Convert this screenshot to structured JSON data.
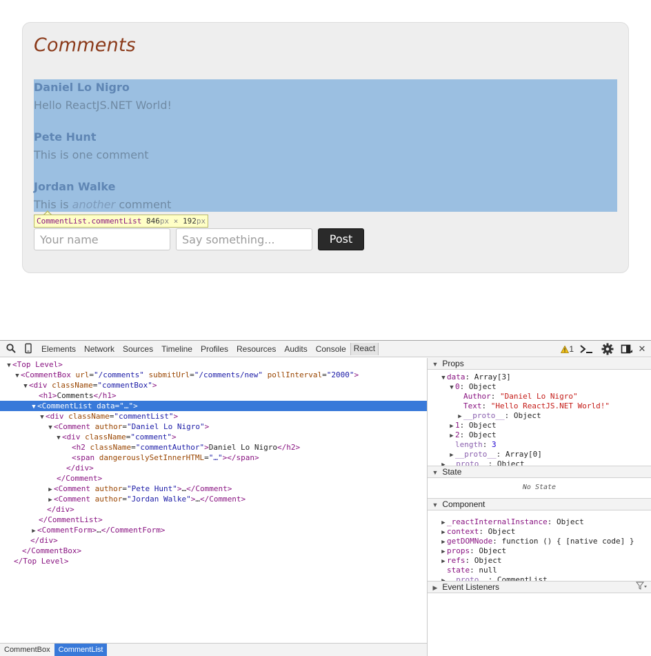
{
  "page": {
    "title": "Comments",
    "comments": [
      {
        "author": "Daniel Lo Nigro",
        "text": "Hello ReactJS.NET World!"
      },
      {
        "author": "Pete Hunt",
        "text": "This is one comment"
      },
      {
        "author": "Jordan Walke",
        "text_before": "This is ",
        "text_em": "another",
        "text_after": " comment"
      }
    ],
    "tooltip": {
      "name": "CommentList.commentList",
      "width": "846",
      "height": "192",
      "unit": "px",
      "times": "×"
    },
    "form": {
      "name_placeholder": "Your name",
      "text_placeholder": "Say something...",
      "post_label": "Post"
    }
  },
  "devtools": {
    "tabs": [
      "Elements",
      "Network",
      "Sources",
      "Timeline",
      "Profiles",
      "Resources",
      "Audits",
      "Console",
      "React"
    ],
    "active_tab": "React",
    "warning_count": "1",
    "icons": [
      "search-icon",
      "device-icon",
      "warning-icon",
      "console-drawer-icon",
      "settings-icon",
      "dock-icon",
      "close-icon"
    ],
    "tree": [
      {
        "tri": "▼",
        "open": "<Top Level>"
      },
      {
        "tri": "▼",
        "tag": "CommentBox",
        "attrs": [
          [
            "url",
            "\"/comments\""
          ],
          [
            "submitUrl",
            "\"/comments/new\""
          ],
          [
            "pollInterval",
            "\"2000\""
          ]
        ]
      },
      {
        "tri": "▼",
        "tag": "div",
        "attrs": [
          [
            "className",
            "\"commentBox\""
          ]
        ]
      },
      {
        "tri": "",
        "raw_open": "<h1>",
        "text": "Comments",
        "raw_close": "</h1>"
      },
      {
        "tri": "▼",
        "tag": "CommentList",
        "attrs": [
          [
            "data",
            "\"…\""
          ]
        ],
        "selected": true
      },
      {
        "tri": "▼",
        "tag": "div",
        "attrs": [
          [
            "className",
            "\"commentList\""
          ]
        ]
      },
      {
        "tri": "▼",
        "tag": "Comment",
        "attrs": [
          [
            "author",
            "\"Daniel Lo Nigro\""
          ]
        ]
      },
      {
        "tri": "▼",
        "tag": "div",
        "attrs": [
          [
            "className",
            "\"comment\""
          ]
        ]
      },
      {
        "tri": "",
        "raw_open": "<h2 ",
        "attr_name": "className",
        "attr_val": "\"commentAuthor\"",
        "raw_mid": ">",
        "text": "Daniel Lo Nigro",
        "raw_close": "</h2>"
      },
      {
        "tri": "",
        "raw_open": "<span ",
        "attr_name": "dangerouslySetInnerHTML",
        "attr_val": "\"…\"",
        "raw_mid": ">",
        "text": "",
        "raw_close": "</span>"
      },
      {
        "tri": "",
        "raw_open": "</div>"
      },
      {
        "tri": "",
        "raw_open": "</Comment>"
      },
      {
        "tri": "▶",
        "raw_open": "<Comment ",
        "attr_name": "author",
        "attr_val": "\"Pete Hunt\"",
        "raw_mid": ">",
        "text": "…",
        "raw_close": "</Comment>"
      },
      {
        "tri": "▶",
        "raw_open": "<Comment ",
        "attr_name": "author",
        "attr_val": "\"Jordan Walke\"",
        "raw_mid": ">",
        "text": "…",
        "raw_close": "</Comment>"
      },
      {
        "tri": "",
        "raw_open": "</div>"
      },
      {
        "tri": "",
        "raw_open": "</CommentList>"
      },
      {
        "tri": "▶",
        "raw_open": "<CommentForm>",
        "text": "…",
        "raw_close": "</CommentForm>"
      },
      {
        "tri": "",
        "raw_open": "</div>"
      },
      {
        "tri": "",
        "raw_open": "</CommentBox>"
      },
      {
        "tri": "",
        "raw_open": "</Top Level>"
      }
    ],
    "breadcrumbs": [
      "CommentBox",
      "CommentList"
    ],
    "sidebar": {
      "props_title": "Props",
      "props": [
        {
          "tri": "▼",
          "key": "data",
          "sep": ": ",
          "val": "Array[3]",
          "cls": "plain"
        },
        {
          "tri": "▼",
          "key": "0",
          "sep": ": ",
          "val": "Object",
          "cls": "plain"
        },
        {
          "tri": "",
          "key": "Author",
          "sep": ": ",
          "val": "\"Daniel Lo Nigro\"",
          "cls": "str"
        },
        {
          "tri": "",
          "key": "Text",
          "sep": ": ",
          "val": "\"Hello ReactJS.NET World!\"",
          "cls": "str"
        },
        {
          "tri": "▶",
          "key": "__proto__",
          "sep": ": ",
          "val": "Object",
          "cls": "plain",
          "grey": true
        },
        {
          "tri": "▶",
          "key": "1",
          "sep": ": ",
          "val": "Object",
          "cls": "plain"
        },
        {
          "tri": "▶",
          "key": "2",
          "sep": ": ",
          "val": "Object",
          "cls": "plain"
        },
        {
          "tri": "",
          "key": "length",
          "sep": ": ",
          "val": "3",
          "cls": "num",
          "grey": true
        },
        {
          "tri": "▶",
          "key": "__proto__",
          "sep": ": ",
          "val": "Array[0]",
          "cls": "plain",
          "grey": true
        },
        {
          "tri": "▶",
          "key": "__proto__",
          "sep": ": ",
          "val": "Object",
          "cls": "plain",
          "grey": true
        }
      ],
      "state_title": "State",
      "no_state": "No State",
      "component_title": "Component",
      "component": [
        {
          "tri": "▶",
          "key": "_reactInternalInstance",
          "sep": ": ",
          "val": "Object",
          "cls": "plain"
        },
        {
          "tri": "▶",
          "key": "context",
          "sep": ": ",
          "val": "Object",
          "cls": "plain"
        },
        {
          "tri": "▶",
          "key": "getDOMNode",
          "sep": ": ",
          "val": "function () { [native code] }",
          "cls": "plain"
        },
        {
          "tri": "▶",
          "key": "props",
          "sep": ": ",
          "val": "Object",
          "cls": "plain"
        },
        {
          "tri": "▶",
          "key": "refs",
          "sep": ": ",
          "val": "Object",
          "cls": "plain"
        },
        {
          "tri": "",
          "key": "state",
          "sep": ": ",
          "val": "null",
          "cls": "plain"
        },
        {
          "tri": "▶",
          "key": "__proto__",
          "sep": ": ",
          "val": "CommentList",
          "cls": "plain",
          "grey": true
        }
      ],
      "listeners_title": "Event Listeners"
    }
  }
}
